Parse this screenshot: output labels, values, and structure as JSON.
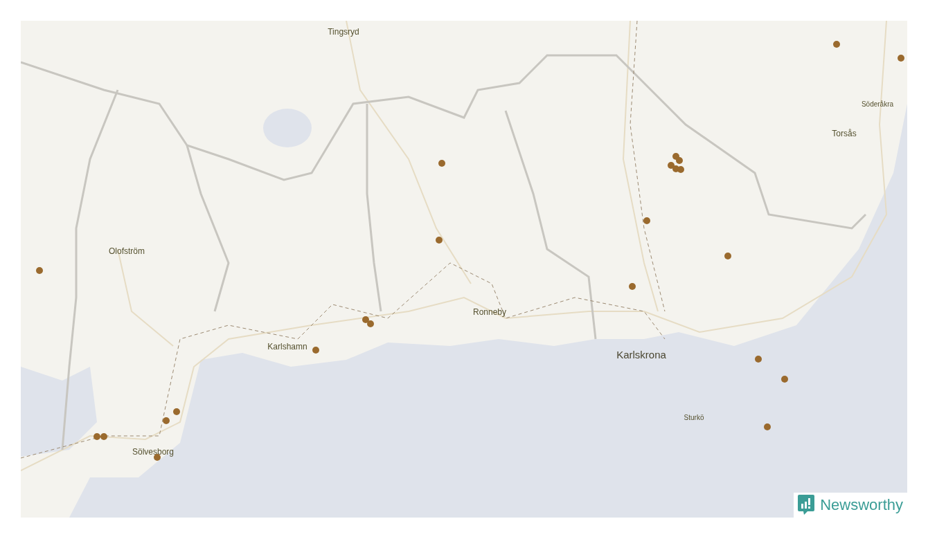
{
  "map": {
    "places": [
      {
        "name": "Tingsryd",
        "kind": "medium"
      },
      {
        "name": "Söderåkra",
        "kind": "small"
      },
      {
        "name": "Torsås",
        "kind": "medium"
      },
      {
        "name": "Olofström",
        "kind": "medium"
      },
      {
        "name": "Ronneby",
        "kind": "medium"
      },
      {
        "name": "Karlshamn",
        "kind": "medium"
      },
      {
        "name": "Karlskrona",
        "kind": "large"
      },
      {
        "name": "Sturkö",
        "kind": "small"
      },
      {
        "name": "Sölvesborg",
        "kind": "medium"
      }
    ],
    "markers": [
      {
        "kind": "dot"
      },
      {
        "kind": "dot"
      },
      {
        "kind": "dot"
      },
      {
        "kind": "dot"
      },
      {
        "kind": "dot"
      },
      {
        "kind": "dot"
      },
      {
        "kind": "dot"
      },
      {
        "kind": "dot"
      },
      {
        "kind": "dot"
      },
      {
        "kind": "dot"
      },
      {
        "kind": "dot"
      },
      {
        "kind": "dot"
      },
      {
        "kind": "dot"
      },
      {
        "kind": "dot"
      },
      {
        "kind": "dot"
      },
      {
        "kind": "dot"
      },
      {
        "kind": "dot"
      },
      {
        "kind": "dot"
      },
      {
        "kind": "dot"
      },
      {
        "kind": "dot"
      },
      {
        "kind": "dot"
      },
      {
        "kind": "dot"
      },
      {
        "kind": "dot"
      },
      {
        "kind": "dot"
      }
    ]
  },
  "logo": {
    "text": "Newsworthy"
  }
}
